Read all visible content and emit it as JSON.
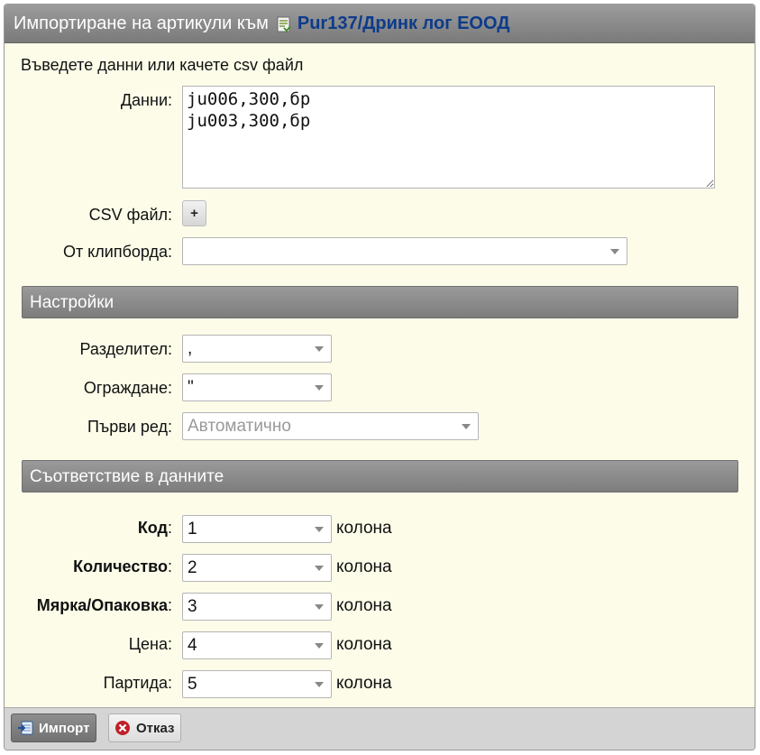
{
  "dialog": {
    "title": "Импортиране на артикули към",
    "doc_link": "Pur137/Дринк лог ЕООД",
    "intro": "Въведете данни или качете csv файл"
  },
  "form": {
    "data_label": "Данни:",
    "data_value": "ju006,300,бр\nju003,300,бр",
    "csv_label": "CSV файл:",
    "csv_button": "+",
    "clipboard_label": "От клипборда:",
    "clipboard_value": ""
  },
  "settings": {
    "header": "Настройки",
    "delimiter_label": "Разделител:",
    "delimiter_value": ",",
    "enclosure_label": "Ограждане:",
    "enclosure_value": "\"",
    "first_row_label": "Първи ред:",
    "first_row_value": "Автоматично"
  },
  "mapping": {
    "header": "Съответствие в данните",
    "suffix": "колона",
    "fields": [
      {
        "label": "Код",
        "bold": true,
        "value": "1"
      },
      {
        "label": "Количество",
        "bold": true,
        "value": "2"
      },
      {
        "label": "Мярка/Опаковка",
        "bold": true,
        "value": "3"
      },
      {
        "label": "Цена",
        "bold": false,
        "value": "4"
      },
      {
        "label": "Партида",
        "bold": false,
        "value": "5"
      }
    ]
  },
  "footer": {
    "import_label": "Импорт",
    "cancel_label": "Отказ"
  },
  "icons": {
    "title_icon": "document-icon",
    "import_icon": "import-icon",
    "cancel_icon": "cancel-icon"
  },
  "colors": {
    "title_link": "#0d3b8a",
    "background": "#fcfce9",
    "header_bar": "#8a8a8a",
    "cancel_red": "#c0202a"
  }
}
